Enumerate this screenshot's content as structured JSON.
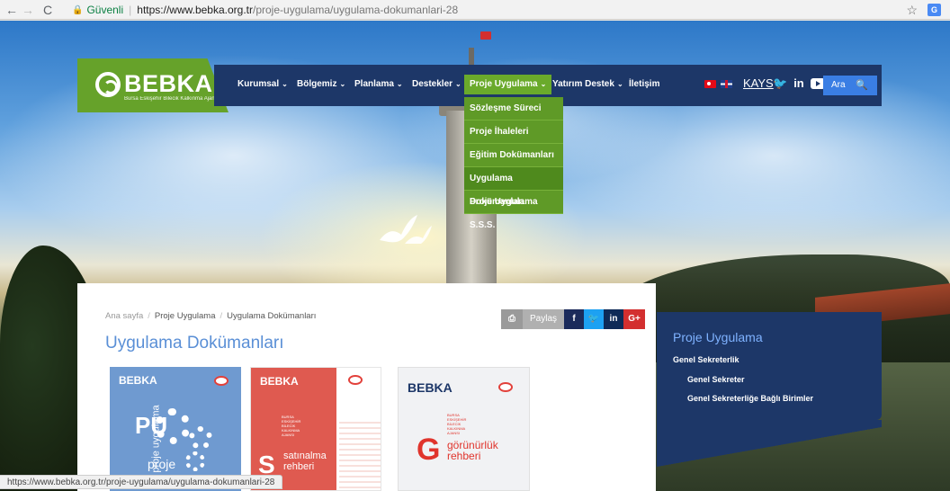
{
  "browser": {
    "secure_label": "Güvenli",
    "url_host": "https://www.bebka.org.tr",
    "url_path": "/proje-uygulama/uygulama-dokumanlari-28",
    "status_url": "https://www.bebka.org.tr/proje-uygulama/uygulama-dokumanlari-28"
  },
  "logo": {
    "text": "BEBKA",
    "subtitle": "Bursa Eskişehir Bilecik Kalkınma Ajansı"
  },
  "nav": {
    "items": [
      {
        "label": "Kurumsal",
        "has_caret": true
      },
      {
        "label": "Bölgemiz",
        "has_caret": true
      },
      {
        "label": "Planlama",
        "has_caret": true
      },
      {
        "label": "Destekler",
        "has_caret": true
      },
      {
        "label": "Proje Uygulama",
        "has_caret": true,
        "active": true
      },
      {
        "label": "Yatırım Destek",
        "has_caret": true
      },
      {
        "label": "İletişim",
        "has_caret": false
      }
    ],
    "kays": "KAYS",
    "search_label": "Ara"
  },
  "dropdown": {
    "items": [
      {
        "label": "Sözleşme Süreci"
      },
      {
        "label": "Proje İhaleleri"
      },
      {
        "label": "Eğitim Dokümanları"
      },
      {
        "label": "Uygulama Dokümanları",
        "hover": true
      },
      {
        "label": "Proje Uygulama S.S.S."
      }
    ]
  },
  "breadcrumb": {
    "home": "Ana sayfa",
    "section": "Proje Uygulama",
    "current": "Uygulama Dokümanları"
  },
  "page_title": "Uygulama Dokümanları",
  "share": {
    "label": "Paylaş",
    "facebook": "f",
    "linkedin": "in",
    "google": "G+"
  },
  "documents": [
    {
      "logo": "BEBKA",
      "letters": "PU",
      "title": "proje",
      "vertical": "proje uygulama"
    },
    {
      "logo": "BEBKA",
      "letter": "S",
      "title_lines": [
        "satınalma",
        "rehberi"
      ],
      "small_lines": [
        "BURSA",
        "ESKİŞEHİR",
        "BİLECİK",
        "KALKINMA",
        "AJANSI"
      ]
    },
    {
      "logo": "BEBKA",
      "letter": "G",
      "title_lines": [
        "görünürlük",
        "rehberi"
      ],
      "small_lines": [
        "BURSA",
        "ESKİŞEHİR",
        "BİLECİK",
        "KALKINMA",
        "AJANSI"
      ]
    }
  ],
  "sidebar": {
    "title": "Proje Uygulama",
    "level1": "Genel Sekreterlik",
    "level2": [
      "Genel Sekreter",
      "Genel Sekreterliğe Bağlı Birimler"
    ]
  },
  "colors": {
    "nav_bg": "#1d3768",
    "brand_green": "#66a22a",
    "title_blue": "#5a8fd6"
  }
}
